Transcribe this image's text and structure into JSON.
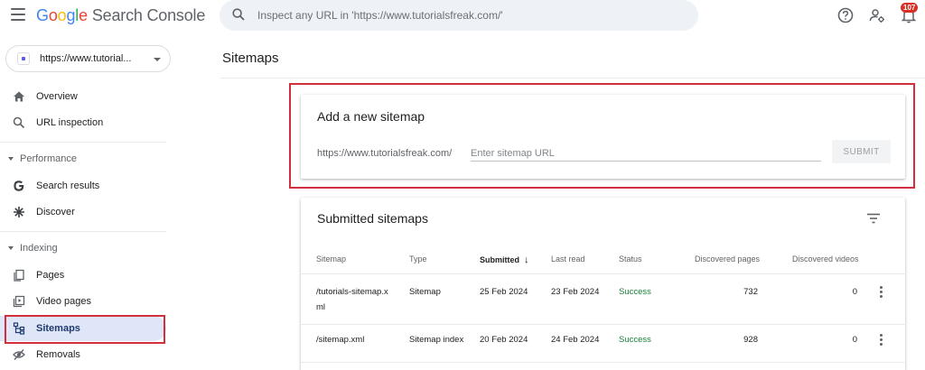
{
  "app": {
    "logo_letters": [
      "G",
      "o",
      "o",
      "g",
      "l",
      "e"
    ],
    "product_name": "Search Console"
  },
  "search": {
    "placeholder": "Inspect any URL in 'https://www.tutorialsfreak.com/'"
  },
  "notifications": {
    "count": "107"
  },
  "property": {
    "label": "https://www.tutorial..."
  },
  "sidebar": {
    "items_top": [
      {
        "label": "Overview",
        "icon": "home-icon"
      },
      {
        "label": "URL inspection",
        "icon": "search-icon"
      }
    ],
    "performance": {
      "label": "Performance",
      "items": [
        {
          "label": "Search results",
          "icon": "google-g-icon"
        },
        {
          "label": "Discover",
          "icon": "discover-asterisk-icon"
        }
      ]
    },
    "indexing": {
      "label": "Indexing",
      "items": [
        {
          "label": "Pages",
          "icon": "pages-icon"
        },
        {
          "label": "Video pages",
          "icon": "video-pages-icon"
        },
        {
          "label": "Sitemaps",
          "icon": "sitemap-icon",
          "active": true
        },
        {
          "label": "Removals",
          "icon": "removals-eye-off-icon"
        }
      ]
    }
  },
  "page": {
    "title": "Sitemaps"
  },
  "add_sitemap": {
    "title": "Add a new sitemap",
    "prefix": "https://www.tutorialsfreak.com/",
    "placeholder": "Enter sitemap URL",
    "submit_label": "SUBMIT"
  },
  "submitted": {
    "title": "Submitted sitemaps",
    "columns": {
      "sitemap": "Sitemap",
      "type": "Type",
      "submitted": "Submitted",
      "submitted_sort_arrow": "↓",
      "last_read": "Last read",
      "status": "Status",
      "discovered_pages": "Discovered pages",
      "discovered_videos": "Discovered videos"
    },
    "rows": [
      {
        "sitemap_line1": "/tutorials-sitemap.x",
        "sitemap_line2": "ml",
        "type": "Sitemap",
        "submitted": "25 Feb 2024",
        "last_read": "23 Feb 2024",
        "status": "Success",
        "discovered_pages": "732",
        "discovered_videos": "0"
      },
      {
        "sitemap_line1": "/sitemap.xml",
        "sitemap_line2": "",
        "type": "Sitemap index",
        "submitted": "20 Feb 2024",
        "last_read": "24 Feb 2024",
        "status": "Success",
        "discovered_pages": "928",
        "discovered_videos": "0"
      }
    ]
  },
  "colors": {
    "highlight_red": "#d32f3a",
    "success_green": "#188038",
    "active_nav_bg": "#dfe6f8",
    "search_bg": "#eef1f5"
  }
}
